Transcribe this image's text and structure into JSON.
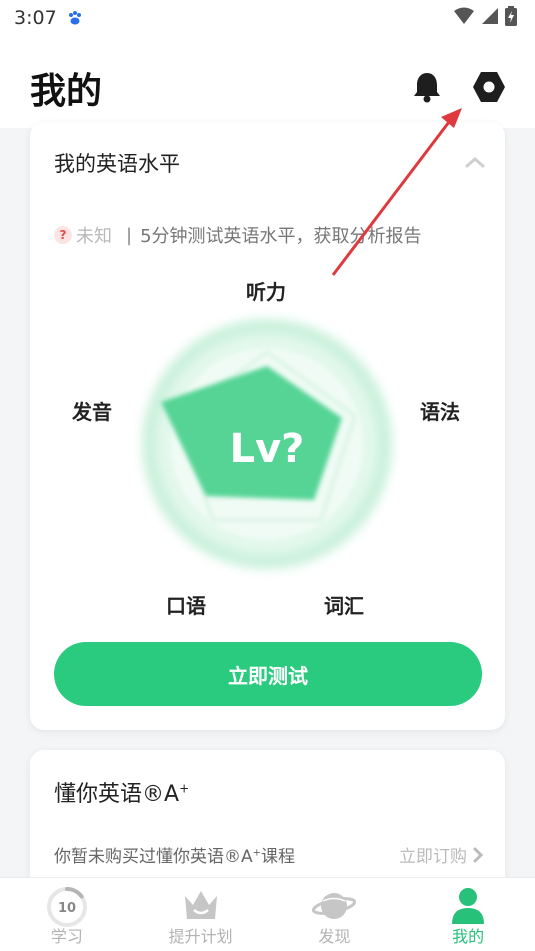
{
  "status_bar": {
    "time": "3:07"
  },
  "header": {
    "title": "我的"
  },
  "level_card": {
    "title": "我的英语水平",
    "badge_mark": "?",
    "level_status": "未知",
    "separator": "|",
    "prompt": "5分钟测试英语水平，获取分析报告",
    "radar_center": "Lv?",
    "axes": {
      "listening": "听力",
      "grammar": "语法",
      "vocabulary": "词汇",
      "speaking": "口语",
      "pronunciation": "发音"
    },
    "button_label": "立即测试"
  },
  "course_card": {
    "title": "懂你英语®A",
    "title_sup": "+",
    "description": "你暂未购买过懂你英语®A",
    "description_sup": "+",
    "description_tail": "课程",
    "subscribe_label": "立即订购"
  },
  "tabs": [
    {
      "label": "学习",
      "badge": "10",
      "progress": 0.15
    },
    {
      "label": "提升计划"
    },
    {
      "label": "发现"
    },
    {
      "label": "我的",
      "active": true
    }
  ],
  "colors": {
    "accent": "#2bcb7f",
    "annotation_arrow": "#e0393d"
  }
}
